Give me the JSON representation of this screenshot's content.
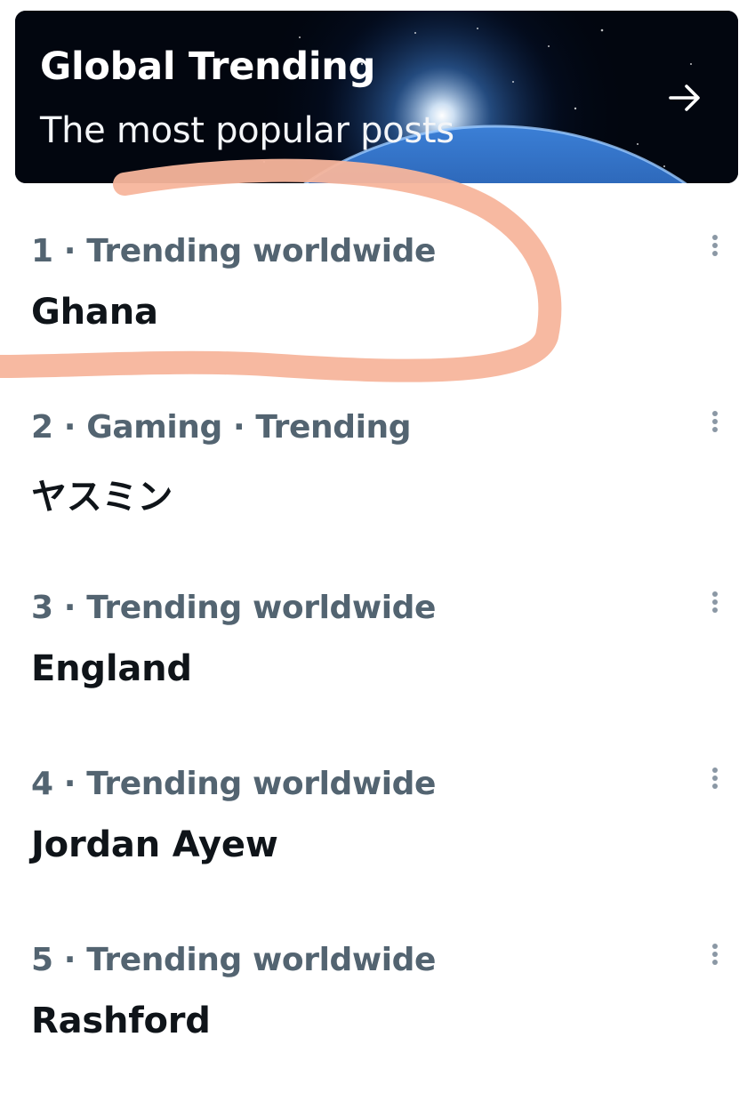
{
  "header": {
    "title": "Global Trending",
    "subtitle": "The most popular posts",
    "arrow_icon": "arrow-right-icon",
    "background": "earth-from-space"
  },
  "trends": [
    {
      "meta": "1 · Trending worldwide",
      "name": "Ghana"
    },
    {
      "meta": "2 · Gaming · Trending",
      "name": "ヤスミン"
    },
    {
      "meta": "3 · Trending worldwide",
      "name": "England"
    },
    {
      "meta": "4 · Trending worldwide",
      "name": "Jordan Ayew"
    },
    {
      "meta": "5 · Trending worldwide",
      "name": "Rashford"
    }
  ],
  "annotation": {
    "color": "#f7b59c",
    "target": "Ghana"
  },
  "colors": {
    "meta_text": "#536471",
    "name_text": "#0f1419",
    "menu_dots": "#8b98a5"
  }
}
